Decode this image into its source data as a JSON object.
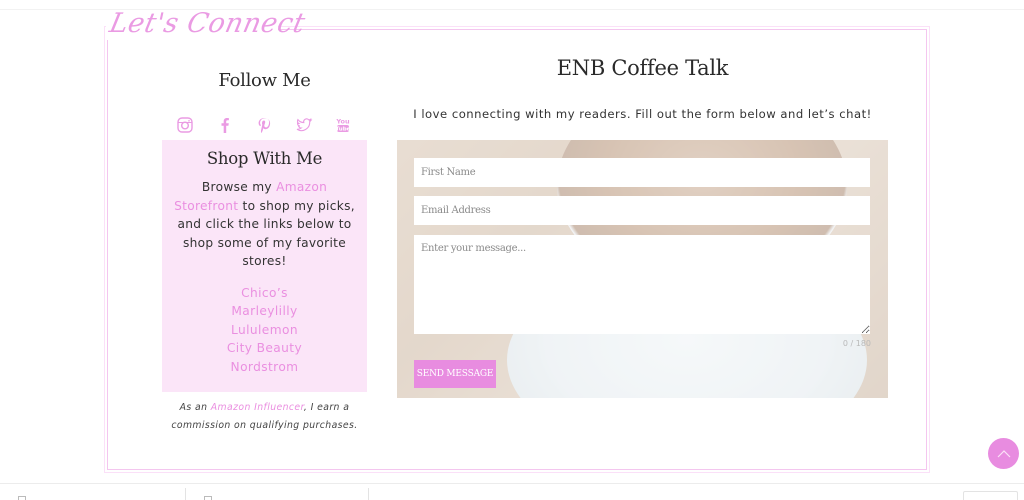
{
  "section": {
    "title": "Let's Connect"
  },
  "follow": {
    "title": "Follow Me",
    "social_icons": [
      "instagram-icon",
      "facebook-icon",
      "pinterest-icon",
      "twitter-icon",
      "youtube-icon"
    ]
  },
  "shop": {
    "title": "Shop With Me",
    "desc_pre": "Browse my ",
    "desc_link": "Amazon Storefront",
    "desc_post": " to shop my picks, and click the links below to shop some of my favorite stores!",
    "stores": [
      "Chico’s",
      "Marleylilly",
      "Lululemon",
      "City Beauty",
      "Nordstrom"
    ]
  },
  "disclaimer": {
    "pre": "As an ",
    "link": "Amazon Influencer",
    "post": ", I earn a commission on qualifying purchases."
  },
  "contact": {
    "title": "ENB Coffee Talk",
    "intro": "I love connecting with my readers. Fill out the form below and let’s chat!",
    "first_name_placeholder": "First Name",
    "email_placeholder": "Email Address",
    "message_placeholder": "Enter your message...",
    "first_name_value": "",
    "email_value": "",
    "message_value": "",
    "char_counter": "0 / 180",
    "send_label": "SEND MESSAGE"
  },
  "colors": {
    "accent_pink": "#e88ce0",
    "box_bg": "#fbe5f8",
    "frame_border": "#f4c6ef"
  },
  "scroll_top": {
    "icon": "chevron-up-icon"
  }
}
